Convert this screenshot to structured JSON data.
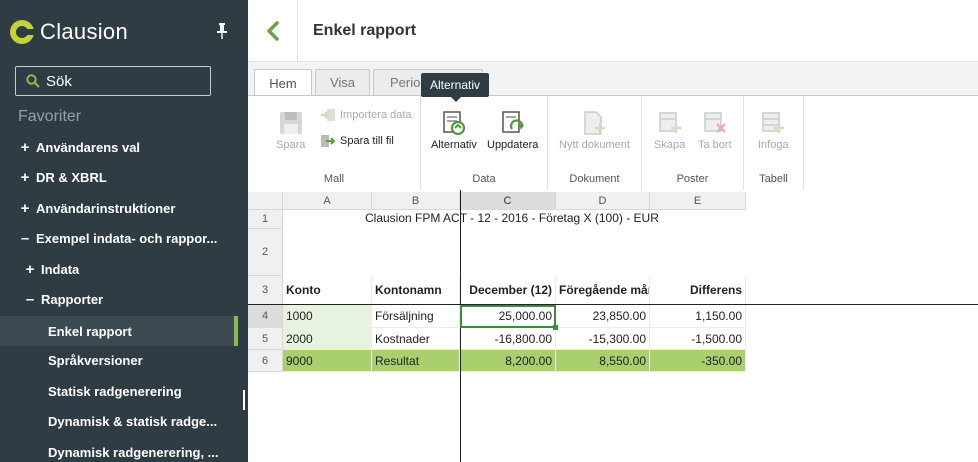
{
  "sidebar": {
    "brand": "Clausion",
    "search_label": "Sök",
    "favorites_title": "Favoriter",
    "items": [
      {
        "sign": "+",
        "label": "Användarens val"
      },
      {
        "sign": "+",
        "label": "DR & XBRL"
      },
      {
        "sign": "+",
        "label": "Användarinstruktioner"
      },
      {
        "sign": "–",
        "label": "Exempel indata- och rappor..."
      },
      {
        "sign": "+",
        "label": "Indata"
      },
      {
        "sign": "–",
        "label": "Rapporter"
      },
      {
        "sign": "",
        "label": "Enkel rapport"
      },
      {
        "sign": "",
        "label": "Språkversioner"
      },
      {
        "sign": "",
        "label": "Statisk radgenerering"
      },
      {
        "sign": "",
        "label": "Dynamisk & statisk radge..."
      },
      {
        "sign": "",
        "label": "Dynamisk radgenerering, ..."
      }
    ]
  },
  "header": {
    "title": "Enkel rapport"
  },
  "ribbon": {
    "tabs": [
      "Hem",
      "Visa",
      "Perio"
    ],
    "tooltip": "Alternativ",
    "groups": {
      "mall": {
        "label": "Mall",
        "spara": "Spara",
        "importera": "Importera data",
        "spara_fil": "Spara till fil"
      },
      "data": {
        "label": "Data",
        "alternativ": "Alternativ",
        "uppdatera": "Uppdatera"
      },
      "dokument": {
        "label": "Dokument",
        "nytt": "Nytt dokument"
      },
      "poster": {
        "label": "Poster",
        "skapa": "Skapa",
        "ta_bort": "Ta bort"
      },
      "tabell": {
        "label": "Tabell",
        "infoga": "Infoga"
      }
    }
  },
  "sheet": {
    "columns": [
      "A",
      "B",
      "C",
      "D",
      "E"
    ],
    "rows": [
      "1",
      "2",
      "3",
      "4",
      "5",
      "6"
    ],
    "title": "Clausion FPM     ACT - 12 - 2016 - Företag X (100) - EUR",
    "header_row": {
      "a": "Konto",
      "b": "Kontonamn",
      "c": "December  (12)",
      "d": "Föregående mån",
      "e": "Differens"
    },
    "data_rows": [
      {
        "a": "1000",
        "b": "Försäljning",
        "c": "25,000.00",
        "d": "23,850.00",
        "e": "1,150.00"
      },
      {
        "a": "2000",
        "b": "Kostnader",
        "c": "-16,800.00",
        "d": "-15,300.00",
        "e": "-1,500.00"
      },
      {
        "a": "9000",
        "b": "Resultat",
        "c": "8,200.00",
        "d": "8,550.00",
        "e": "-350.00"
      }
    ]
  },
  "colors": {
    "sidebar_bg": "#2f3c43",
    "accent_green": "#8bbb4e",
    "result_row": "#a9cf6f",
    "light_green": "#e8f3df"
  }
}
